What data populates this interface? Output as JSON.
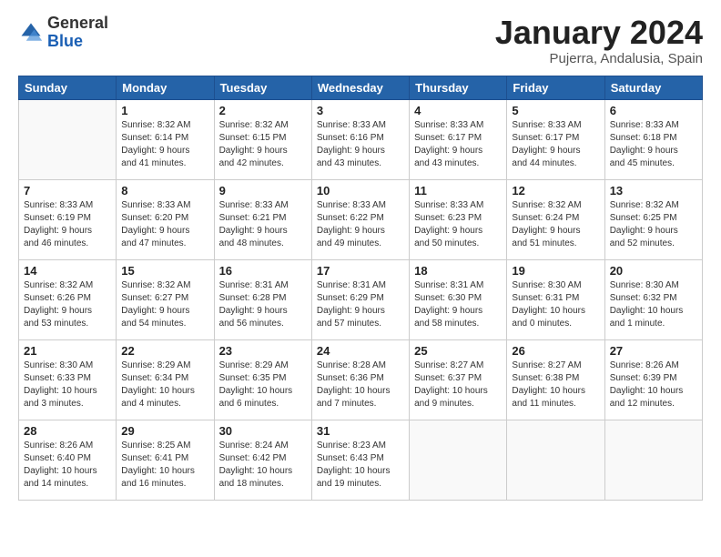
{
  "header": {
    "logo_general": "General",
    "logo_blue": "Blue",
    "title": "January 2024",
    "subtitle": "Pujerra, Andalusia, Spain"
  },
  "days_of_week": [
    "Sunday",
    "Monday",
    "Tuesday",
    "Wednesday",
    "Thursday",
    "Friday",
    "Saturday"
  ],
  "weeks": [
    [
      {
        "day": "",
        "info": ""
      },
      {
        "day": "1",
        "info": "Sunrise: 8:32 AM\nSunset: 6:14 PM\nDaylight: 9 hours\nand 41 minutes."
      },
      {
        "day": "2",
        "info": "Sunrise: 8:32 AM\nSunset: 6:15 PM\nDaylight: 9 hours\nand 42 minutes."
      },
      {
        "day": "3",
        "info": "Sunrise: 8:33 AM\nSunset: 6:16 PM\nDaylight: 9 hours\nand 43 minutes."
      },
      {
        "day": "4",
        "info": "Sunrise: 8:33 AM\nSunset: 6:17 PM\nDaylight: 9 hours\nand 43 minutes."
      },
      {
        "day": "5",
        "info": "Sunrise: 8:33 AM\nSunset: 6:17 PM\nDaylight: 9 hours\nand 44 minutes."
      },
      {
        "day": "6",
        "info": "Sunrise: 8:33 AM\nSunset: 6:18 PM\nDaylight: 9 hours\nand 45 minutes."
      }
    ],
    [
      {
        "day": "7",
        "info": "Sunrise: 8:33 AM\nSunset: 6:19 PM\nDaylight: 9 hours\nand 46 minutes."
      },
      {
        "day": "8",
        "info": "Sunrise: 8:33 AM\nSunset: 6:20 PM\nDaylight: 9 hours\nand 47 minutes."
      },
      {
        "day": "9",
        "info": "Sunrise: 8:33 AM\nSunset: 6:21 PM\nDaylight: 9 hours\nand 48 minutes."
      },
      {
        "day": "10",
        "info": "Sunrise: 8:33 AM\nSunset: 6:22 PM\nDaylight: 9 hours\nand 49 minutes."
      },
      {
        "day": "11",
        "info": "Sunrise: 8:33 AM\nSunset: 6:23 PM\nDaylight: 9 hours\nand 50 minutes."
      },
      {
        "day": "12",
        "info": "Sunrise: 8:32 AM\nSunset: 6:24 PM\nDaylight: 9 hours\nand 51 minutes."
      },
      {
        "day": "13",
        "info": "Sunrise: 8:32 AM\nSunset: 6:25 PM\nDaylight: 9 hours\nand 52 minutes."
      }
    ],
    [
      {
        "day": "14",
        "info": "Sunrise: 8:32 AM\nSunset: 6:26 PM\nDaylight: 9 hours\nand 53 minutes."
      },
      {
        "day": "15",
        "info": "Sunrise: 8:32 AM\nSunset: 6:27 PM\nDaylight: 9 hours\nand 54 minutes."
      },
      {
        "day": "16",
        "info": "Sunrise: 8:31 AM\nSunset: 6:28 PM\nDaylight: 9 hours\nand 56 minutes."
      },
      {
        "day": "17",
        "info": "Sunrise: 8:31 AM\nSunset: 6:29 PM\nDaylight: 9 hours\nand 57 minutes."
      },
      {
        "day": "18",
        "info": "Sunrise: 8:31 AM\nSunset: 6:30 PM\nDaylight: 9 hours\nand 58 minutes."
      },
      {
        "day": "19",
        "info": "Sunrise: 8:30 AM\nSunset: 6:31 PM\nDaylight: 10 hours\nand 0 minutes."
      },
      {
        "day": "20",
        "info": "Sunrise: 8:30 AM\nSunset: 6:32 PM\nDaylight: 10 hours\nand 1 minute."
      }
    ],
    [
      {
        "day": "21",
        "info": "Sunrise: 8:30 AM\nSunset: 6:33 PM\nDaylight: 10 hours\nand 3 minutes."
      },
      {
        "day": "22",
        "info": "Sunrise: 8:29 AM\nSunset: 6:34 PM\nDaylight: 10 hours\nand 4 minutes."
      },
      {
        "day": "23",
        "info": "Sunrise: 8:29 AM\nSunset: 6:35 PM\nDaylight: 10 hours\nand 6 minutes."
      },
      {
        "day": "24",
        "info": "Sunrise: 8:28 AM\nSunset: 6:36 PM\nDaylight: 10 hours\nand 7 minutes."
      },
      {
        "day": "25",
        "info": "Sunrise: 8:27 AM\nSunset: 6:37 PM\nDaylight: 10 hours\nand 9 minutes."
      },
      {
        "day": "26",
        "info": "Sunrise: 8:27 AM\nSunset: 6:38 PM\nDaylight: 10 hours\nand 11 minutes."
      },
      {
        "day": "27",
        "info": "Sunrise: 8:26 AM\nSunset: 6:39 PM\nDaylight: 10 hours\nand 12 minutes."
      }
    ],
    [
      {
        "day": "28",
        "info": "Sunrise: 8:26 AM\nSunset: 6:40 PM\nDaylight: 10 hours\nand 14 minutes."
      },
      {
        "day": "29",
        "info": "Sunrise: 8:25 AM\nSunset: 6:41 PM\nDaylight: 10 hours\nand 16 minutes."
      },
      {
        "day": "30",
        "info": "Sunrise: 8:24 AM\nSunset: 6:42 PM\nDaylight: 10 hours\nand 18 minutes."
      },
      {
        "day": "31",
        "info": "Sunrise: 8:23 AM\nSunset: 6:43 PM\nDaylight: 10 hours\nand 19 minutes."
      },
      {
        "day": "",
        "info": ""
      },
      {
        "day": "",
        "info": ""
      },
      {
        "day": "",
        "info": ""
      }
    ]
  ]
}
